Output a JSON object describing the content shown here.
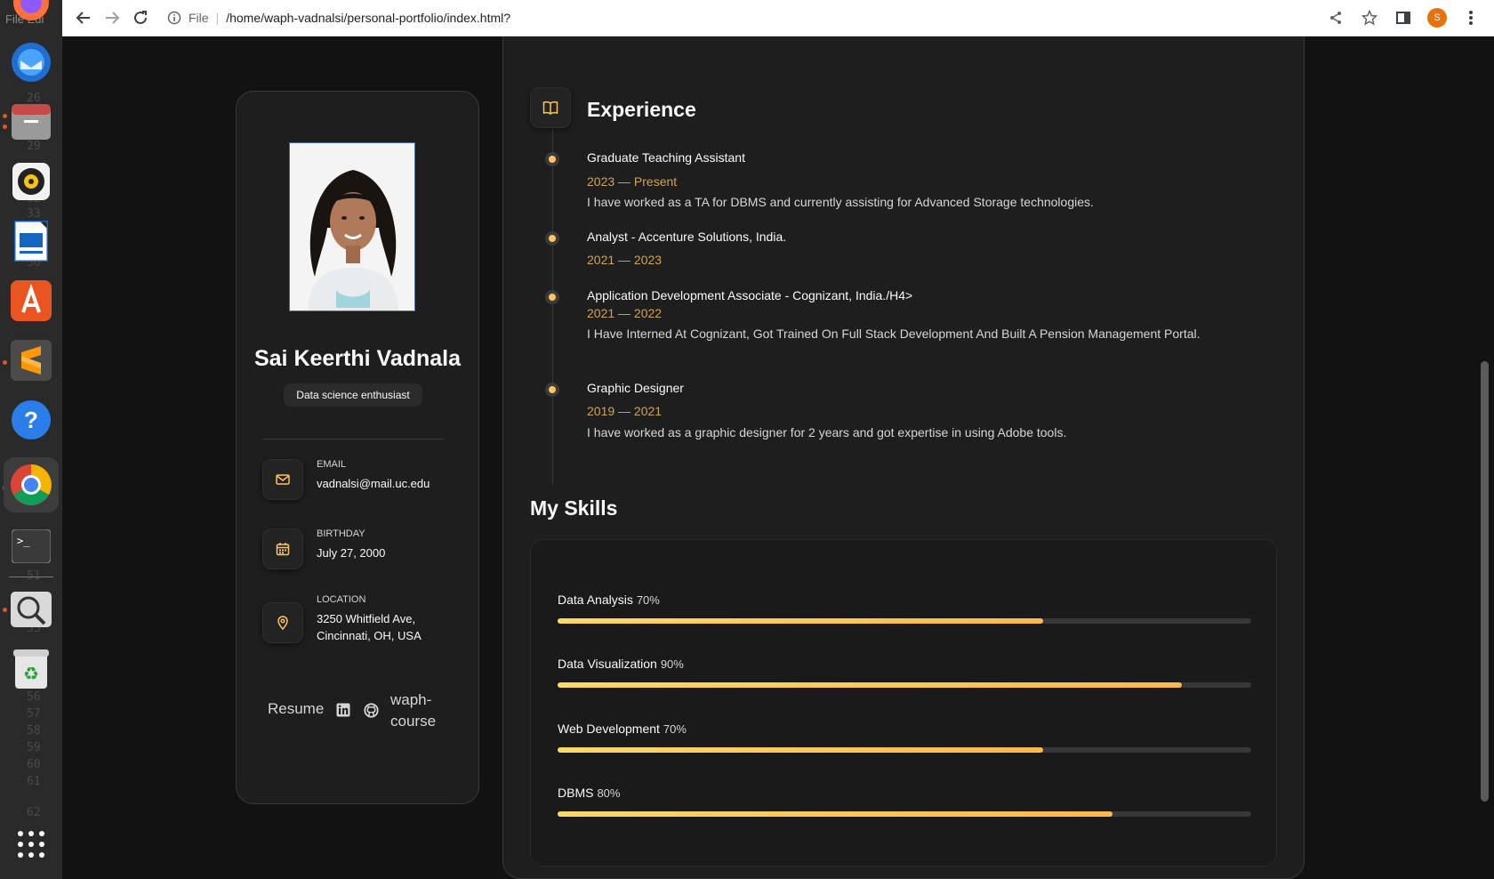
{
  "browser": {
    "url_scheme_label": "File",
    "url": "/home/waph-vadnalsi/personal-portfolio/index.html?",
    "profile_initial": "S"
  },
  "dock": {
    "ghost_menu_text": "File  Edi",
    "ghost_line_numbers": [
      "26",
      "29",
      "32",
      "33",
      "36",
      "39",
      "42",
      "46",
      "51",
      "53",
      "56",
      "57",
      "58",
      "59",
      "60",
      "61",
      "62"
    ],
    "apps": [
      "thunderbird-icon",
      "files-icon",
      "rhythmbox-icon",
      "writer-icon",
      "app-center-icon",
      "sublime-text-icon",
      "help-icon",
      "chrome-icon",
      "terminal-icon",
      "image-viewer-icon",
      "trash-icon"
    ]
  },
  "profile": {
    "name": "Sai Keerthi Vadnala",
    "title": "Data science enthusiast",
    "contacts": [
      {
        "label": "Email",
        "value": "vadnalsi@mail.uc.edu",
        "icon": "mail-icon"
      },
      {
        "label": "Birthday",
        "value": "July 27, 2000",
        "icon": "calendar-icon"
      },
      {
        "label": "Location",
        "value": "3250 Whitfield Ave, Cincinnati, OH, USA",
        "icon": "location-icon"
      }
    ],
    "social": {
      "resume": "Resume",
      "waph": "waph-course"
    }
  },
  "experience": {
    "title": "Experience",
    "items": [
      {
        "role": "Graduate Teaching Assistant",
        "dates": "2023 — Present",
        "desc": "I have worked as a TA for DBMS and currently assisting for Advanced Storage technologies."
      },
      {
        "role": "Analyst - Accenture Solutions, India.",
        "dates": "2021 — 2023",
        "desc": ""
      },
      {
        "role": "Application Development Associate - Cognizant, India./H4>",
        "dates": "2021 — 2022",
        "desc": "I Have Interned At Cognizant, Got Trained On Full Stack Development And Built A Pension Management Portal."
      },
      {
        "role": "Graphic Designer",
        "dates": "2019 — 2021",
        "desc": "I have worked as a graphic designer for 2 years and got expertise in using Adobe tools."
      }
    ]
  },
  "skills": {
    "title": "My Skills",
    "items": [
      {
        "name": "Data Analysis",
        "percent_label": "70%",
        "fill_fraction": 0.7
      },
      {
        "name": "Data Visualization",
        "percent_label": "90%",
        "fill_fraction": 0.9
      },
      {
        "name": "Web Development",
        "percent_label": "70%",
        "fill_fraction": 0.7
      },
      {
        "name": "DBMS",
        "percent_label": "80%",
        "fill_fraction": 0.8
      }
    ]
  },
  "colors": {
    "accent": "#ffc45b",
    "date_text": "#cea35b",
    "card_bg": "#1e1e1f",
    "page_bg": "#121212"
  }
}
